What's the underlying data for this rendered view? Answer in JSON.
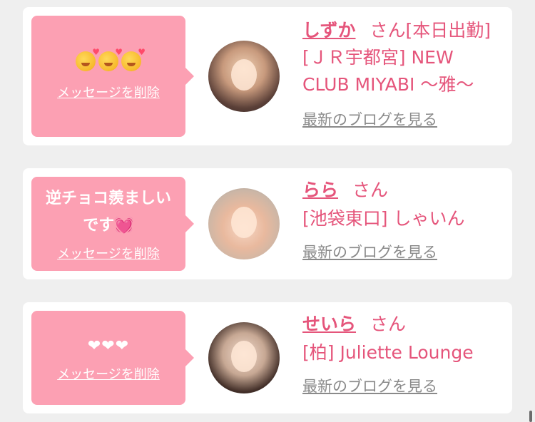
{
  "messages": [
    {
      "message_text": "",
      "message_icons": [
        "smiling-face-with-hearts-icon",
        "smiling-face-with-hearts-icon",
        "smiling-face-with-hearts-icon"
      ],
      "delete_label": "メッセージを削除",
      "name": "しずか",
      "honorific_status": "さん[本日出勤]",
      "shop": "[ＪＲ宇都宮] NEW CLUB MIYABI 〜雅〜",
      "blog_label": "最新のブログを見る"
    },
    {
      "message_line1": "逆チョコ羨ましい",
      "message_line2": "です💓",
      "delete_label": "メッセージを削除",
      "name": "らら",
      "honorific_status": "さん",
      "shop": "[池袋東口] しゃいん",
      "blog_label": "最新のブログを見る"
    },
    {
      "message_text": "❤❤❤",
      "delete_label": "メッセージを削除",
      "name": "せいら",
      "honorific_status": "さん",
      "shop": "[柏] Juliette Lounge",
      "blog_label": "最新のブログを見る"
    }
  ],
  "colors": {
    "bubble": "#fca0b3",
    "accent_text": "#e5557b",
    "link_gray": "#8a8a8a",
    "background": "#efefef",
    "card": "#ffffff"
  }
}
